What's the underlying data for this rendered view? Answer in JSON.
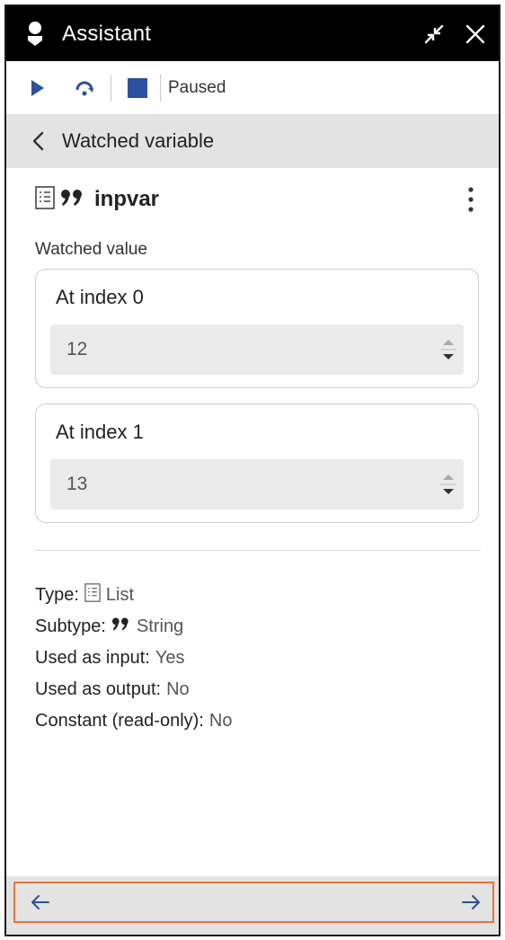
{
  "titlebar": {
    "title": "Assistant"
  },
  "toolbar": {
    "status": "Paused"
  },
  "header": {
    "title": "Watched variable"
  },
  "variable": {
    "name": "inpvar"
  },
  "watched": {
    "label": "Watched value",
    "items": [
      {
        "title": "At index 0",
        "value": "12"
      },
      {
        "title": "At index 1",
        "value": "13"
      }
    ]
  },
  "properties": {
    "type_label": "Type:",
    "type_value": "List",
    "subtype_label": "Subtype:",
    "subtype_value": "String",
    "input_label": "Used as input:",
    "input_value": "Yes",
    "output_label": "Used as output:",
    "output_value": "No",
    "constant_label": "Constant (read-only):",
    "constant_value": "No"
  },
  "colors": {
    "titlebar_bg": "#000000",
    "accent_play": "#2c4f9e",
    "footer_border": "#e8743b"
  },
  "icons": [
    "assistant-icon",
    "collapse-icon",
    "close-icon",
    "play-icon",
    "step-over-icon",
    "stop-icon",
    "back-chevron-icon",
    "list-icon",
    "quote-icon",
    "kebab-menu-icon",
    "arrow-left-icon",
    "arrow-right-icon"
  ]
}
